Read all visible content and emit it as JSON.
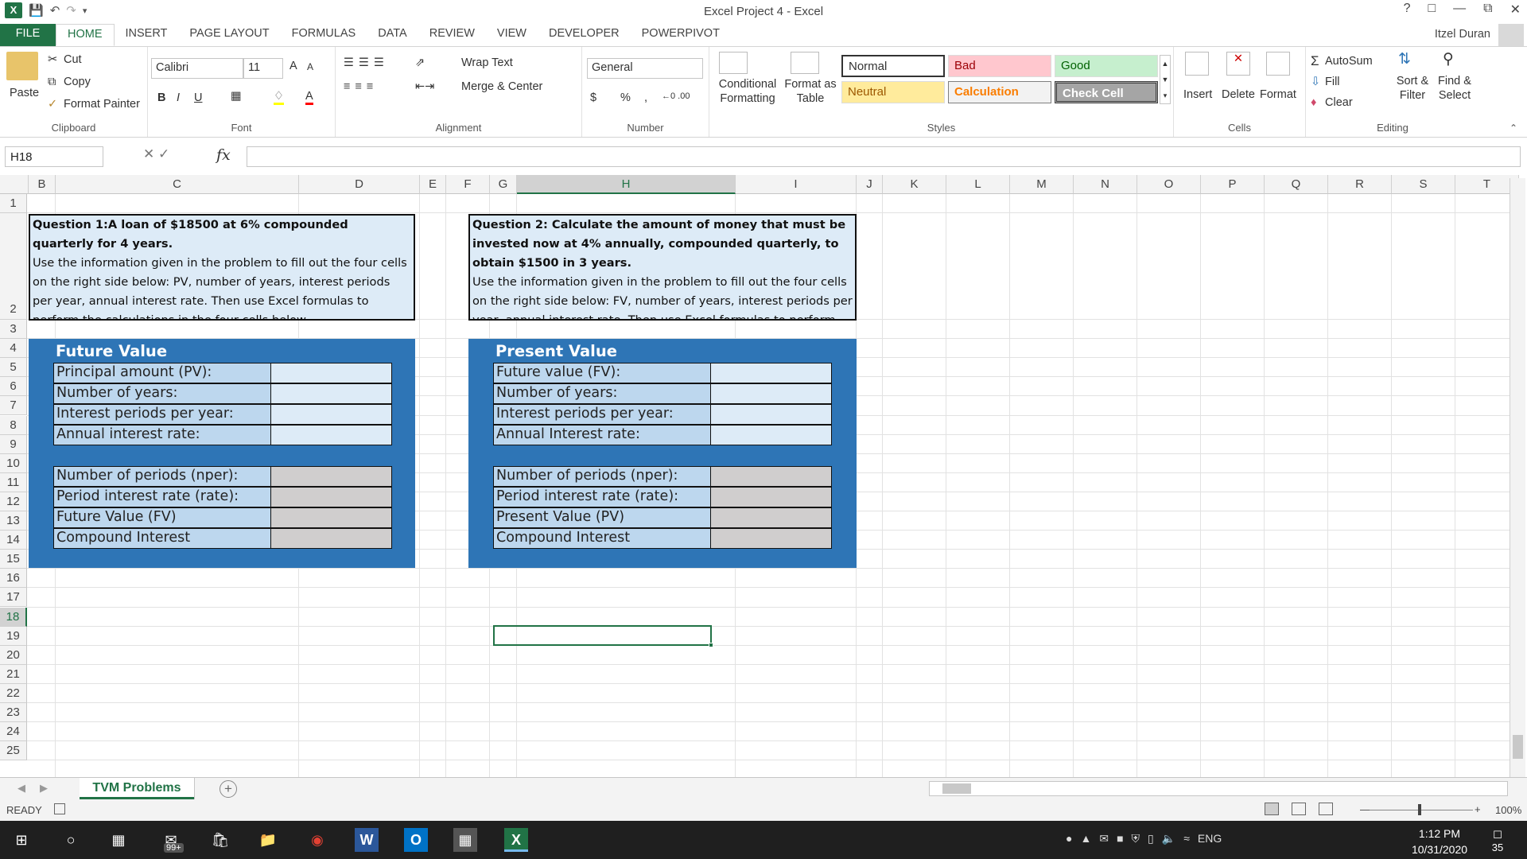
{
  "window": {
    "title": "Excel Project 4 - Excel",
    "user": "Itzel Duran",
    "help": "?"
  },
  "tabs": [
    "FILE",
    "HOME",
    "INSERT",
    "PAGE LAYOUT",
    "FORMULAS",
    "DATA",
    "REVIEW",
    "VIEW",
    "DEVELOPER",
    "POWERPIVOT"
  ],
  "ribbon": {
    "clipboard": {
      "paste": "Paste",
      "cut": "Cut",
      "copy": "Copy",
      "format_painter": "Format Painter",
      "label": "Clipboard"
    },
    "font": {
      "name": "Calibri",
      "size": "11",
      "label": "Font",
      "grow": "A",
      "shrink": "A",
      "bold": "B",
      "italic": "I",
      "underline": "U",
      "font_color": "A"
    },
    "alignment": {
      "wrap": "Wrap Text",
      "merge": "Merge & Center",
      "label": "Alignment"
    },
    "number": {
      "format": "General",
      "currency": "$",
      "percent": "%",
      "comma": ",",
      "label": "Number"
    },
    "styles": {
      "conditional": "Conditional Formatting",
      "format_table": "Format as Table",
      "normal": "Normal",
      "bad": "Bad",
      "good": "Good",
      "neutral": "Neutral",
      "calculation": "Calculation",
      "check_cell": "Check Cell",
      "label": "Styles"
    },
    "cells": {
      "insert": "Insert",
      "delete": "Delete",
      "format": "Format",
      "label": "Cells"
    },
    "editing": {
      "autosum": "AutoSum",
      "fill": "Fill",
      "clear": "Clear",
      "sort": "Sort & Filter",
      "find": "Find & Select",
      "label": "Editing"
    }
  },
  "formula_bar": {
    "name_box": "H18",
    "formula": "",
    "fx": "fx"
  },
  "columns": [
    "B",
    "C",
    "D",
    "E",
    "F",
    "G",
    "H",
    "I",
    "J",
    "K",
    "L",
    "M",
    "N",
    "O",
    "P",
    "Q",
    "R",
    "S",
    "T"
  ],
  "rows": [
    "1",
    "2",
    "3",
    "4",
    "5",
    "6",
    "7",
    "8",
    "9",
    "10",
    "11",
    "12",
    "13",
    "14",
    "15",
    "16",
    "17",
    "18",
    "19",
    "20",
    "21",
    "22",
    "23",
    "24",
    "25"
  ],
  "selected_cell": "H18",
  "question1": {
    "title": "Question 1:A loan of $18500 at 6% compounded quarterly for 4 years.",
    "body": "Use the information given in the problem  to fill out the four cells on the right side below: PV, number of years, interest periods per year, annual interest rate. Then use Excel formulas to perform the calculations in the four cells below."
  },
  "question2": {
    "title": "Question 2: Calculate the amount of money that must be invested now at 4% annually, compounded quarterly, to obtain $1500 in 3 years.",
    "body": "Use the information given in the problem  to fill out the four cells on the right side below: FV, number of years, interest periods per year, annual interest rate. Then use Excel formulas to perform the calculations in the four cells below."
  },
  "future_value": {
    "title": "Future Value",
    "inputs": [
      "Principal  amount (PV):",
      "Number of years:",
      "Interest periods per year:",
      "Annual interest rate:"
    ],
    "outputs": [
      "Number of periods (nper):",
      "Period interest rate (rate):",
      "Future Value (FV)",
      "Compound Interest"
    ]
  },
  "present_value": {
    "title": "Present Value",
    "inputs": [
      "Future value (FV):",
      "Number of years:",
      "Interest periods per year:",
      "Annual Interest rate:"
    ],
    "outputs": [
      "Number of periods (nper):",
      "Period interest rate (rate):",
      "Present Value (PV)",
      "Compound Interest"
    ]
  },
  "sheet_tabs": [
    "TVM Problems"
  ],
  "status": {
    "ready": "READY",
    "zoom": "100%"
  },
  "taskbar": {
    "time": "1:12 PM",
    "date": "10/31/2020",
    "lang": "ENG",
    "badge": "99+",
    "notifications": "35"
  }
}
